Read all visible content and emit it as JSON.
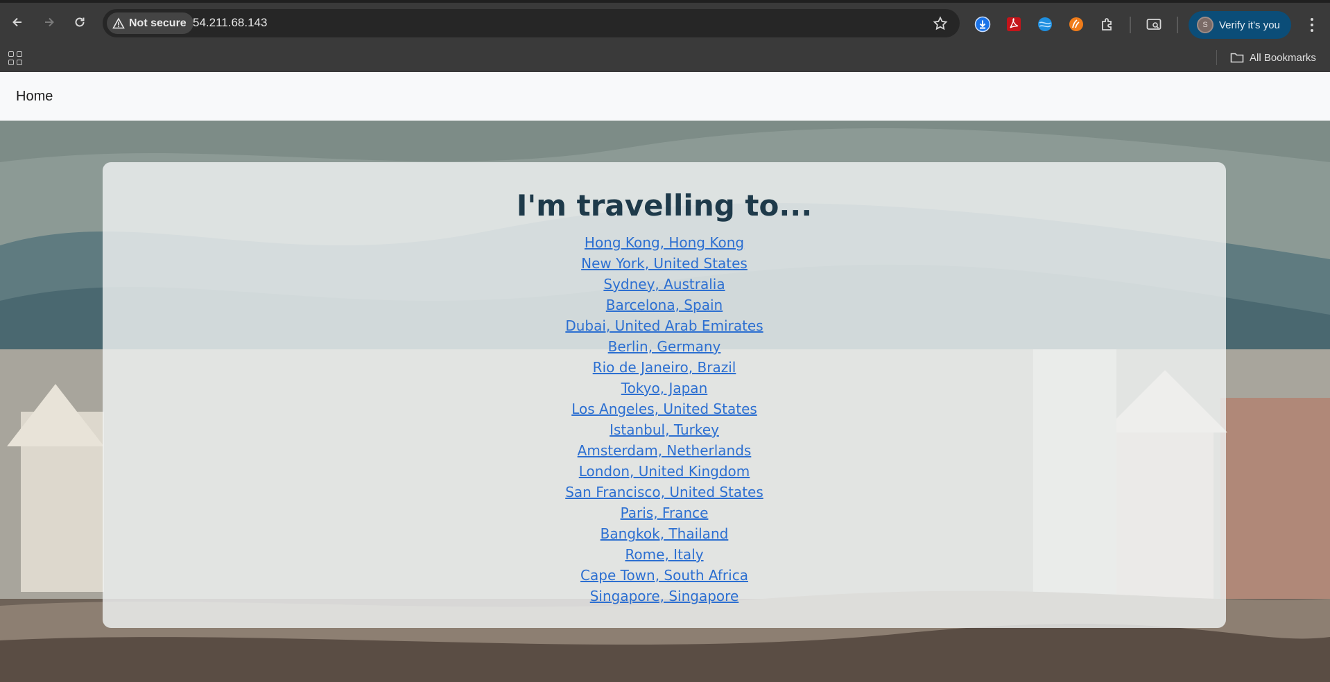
{
  "browser": {
    "security_label": "Not secure",
    "url": "54.211.68.143",
    "profile_initial": "S",
    "profile_label": "Verify it's you",
    "bookmarks_label": "All Bookmarks",
    "icons": [
      "back-icon",
      "forward-icon",
      "reload-icon",
      "warning-icon",
      "star-icon",
      "download-icon",
      "pdf-icon",
      "extension-globe-icon",
      "extension-wave-icon",
      "extensions-puzzle-icon",
      "search-tab-icon",
      "more-icon",
      "apps-icon",
      "folder-icon"
    ]
  },
  "navbar": {
    "home_label": "Home"
  },
  "main": {
    "heading": "I'm travelling to...",
    "destinations": [
      "Hong Kong, Hong Kong",
      "New York, United States",
      "Sydney, Australia",
      "Barcelona, Spain",
      "Dubai, United Arab Emirates",
      "Berlin, Germany",
      "Rio de Janeiro, Brazil",
      "Tokyo, Japan",
      "Los Angeles, United States",
      "Istanbul, Turkey",
      "Amsterdam, Netherlands",
      "London, United Kingdom",
      "San Francisco, United States",
      "Paris, France",
      "Bangkok, Thailand",
      "Rome, Italy",
      "Cape Town, South Africa",
      "Singapore, Singapore"
    ]
  },
  "colors": {
    "link": "#2c6fd1",
    "heading": "#1e3a4a",
    "verify_pill": "#0b4d78"
  }
}
